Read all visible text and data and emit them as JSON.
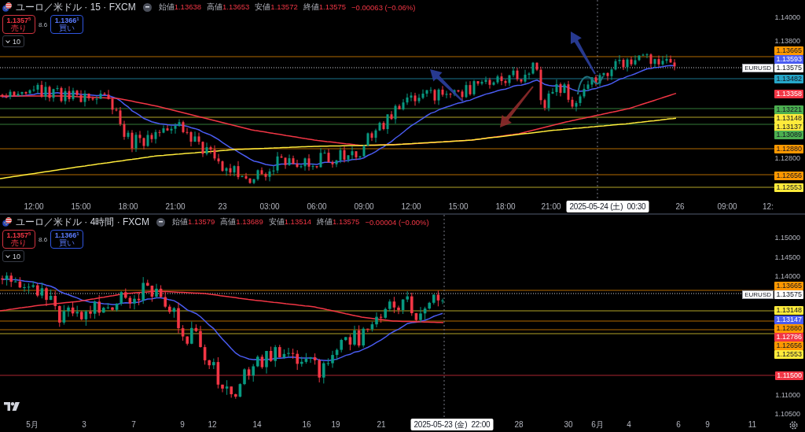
{
  "panes": [
    {
      "title": "ユーロ／米ドル · 15 · FXCM",
      "ohlc": [
        {
          "label": "始値",
          "value": "1.13638"
        },
        {
          "label": "高値",
          "value": "1.13653"
        },
        {
          "label": "安値",
          "value": "1.13572"
        },
        {
          "label": "終値",
          "value": "1.13575"
        }
      ],
      "change": "−0.00063 (−0.06%)",
      "sell": {
        "price": "1.1357$^{5}$",
        "label": "売り"
      },
      "spread": "8.6",
      "buy": {
        "price": "1.1366$^{1}$",
        "label": "買い"
      },
      "indicators": "10",
      "price_axis": {
        "ticks": [
          "1.14000",
          "1.13800",
          "1.12800"
        ],
        "tags": [
          {
            "kind": "level",
            "label": "1.13665",
            "color": "#ff9800"
          },
          {
            "kind": "indicator",
            "label": "1.13593",
            "color": "#4a5cf2"
          },
          {
            "kind": "current",
            "symbol": "EURUSD",
            "label": "1.13575",
            "color": "#ffffff"
          },
          {
            "kind": "level",
            "label": "1.13482",
            "color": "#26a6c8"
          },
          {
            "kind": "indicator",
            "label": "1.13358",
            "color": "#f23645"
          },
          {
            "kind": "level",
            "label": "1.13221",
            "color": "#4caf50"
          },
          {
            "kind": "level",
            "label": "1.13148",
            "color": "#ffeb3b"
          },
          {
            "kind": "indicator",
            "label": "1.13137",
            "color": "#ffeb3b"
          },
          {
            "kind": "level",
            "label": "1.13089",
            "color": "#4caf50"
          },
          {
            "kind": "level",
            "label": "1.12880",
            "color": "#ff9800"
          },
          {
            "kind": "level",
            "label": "1.12656",
            "color": "#ff9800"
          },
          {
            "kind": "level",
            "label": "1.12553",
            "color": "#ffeb3b"
          }
        ]
      },
      "time_axis": {
        "ticks": [
          "12:00",
          "15:00",
          "18:00",
          "21:00",
          "23",
          "03:00",
          "06:00",
          "09:00",
          "12:00",
          "15:00",
          "18:00",
          "21:00",
          "26",
          "09:00",
          "12:"
        ],
        "crosshair": "2025-05-24 (土)  00:30"
      }
    },
    {
      "title": "ユーロ／米ドル · 4時間 · FXCM",
      "ohlc": [
        {
          "label": "始値",
          "value": "1.13579"
        },
        {
          "label": "高値",
          "value": "1.13689"
        },
        {
          "label": "安値",
          "value": "1.13514"
        },
        {
          "label": "終値",
          "value": "1.13575"
        }
      ],
      "change": "−0.00004 (−0.00%)",
      "sell": {
        "price": "1.1357$^{5}$",
        "label": "売り"
      },
      "spread": "8.6",
      "buy": {
        "price": "1.1366$^{1}$",
        "label": "買い"
      },
      "indicators": "10",
      "price_axis": {
        "ticks": [
          "1.15000",
          "1.14500",
          "1.14000",
          "1.11000",
          "1.10500"
        ],
        "tags": [
          {
            "kind": "level",
            "label": "1.13665",
            "color": "#ff9800"
          },
          {
            "kind": "current",
            "symbol": "EURUSD",
            "label": "1.13575",
            "color": "#ffffff"
          },
          {
            "kind": "level",
            "label": "1.13148",
            "color": "#ffeb3b"
          },
          {
            "kind": "indicator",
            "label": "1.13147",
            "color": "#4a5cf2"
          },
          {
            "kind": "level",
            "label": "1.12880",
            "color": "#ff9800"
          },
          {
            "kind": "indicator",
            "label": "1.12786",
            "color": "#f23645"
          },
          {
            "kind": "level",
            "label": "1.12656",
            "color": "#ff9800"
          },
          {
            "kind": "level",
            "label": "1.12553",
            "color": "#ffeb3b"
          },
          {
            "kind": "level",
            "label": "1.11500",
            "color": "#f23645"
          }
        ]
      },
      "time_axis": {
        "ticks": [
          "5月",
          "3",
          "7",
          "9",
          "12",
          "14",
          "16",
          "19",
          "21",
          "28",
          "30",
          "6月",
          "4",
          "6",
          "9",
          "11"
        ],
        "crosshair": "2025-05-23 (金)  22:00"
      }
    }
  ]
}
